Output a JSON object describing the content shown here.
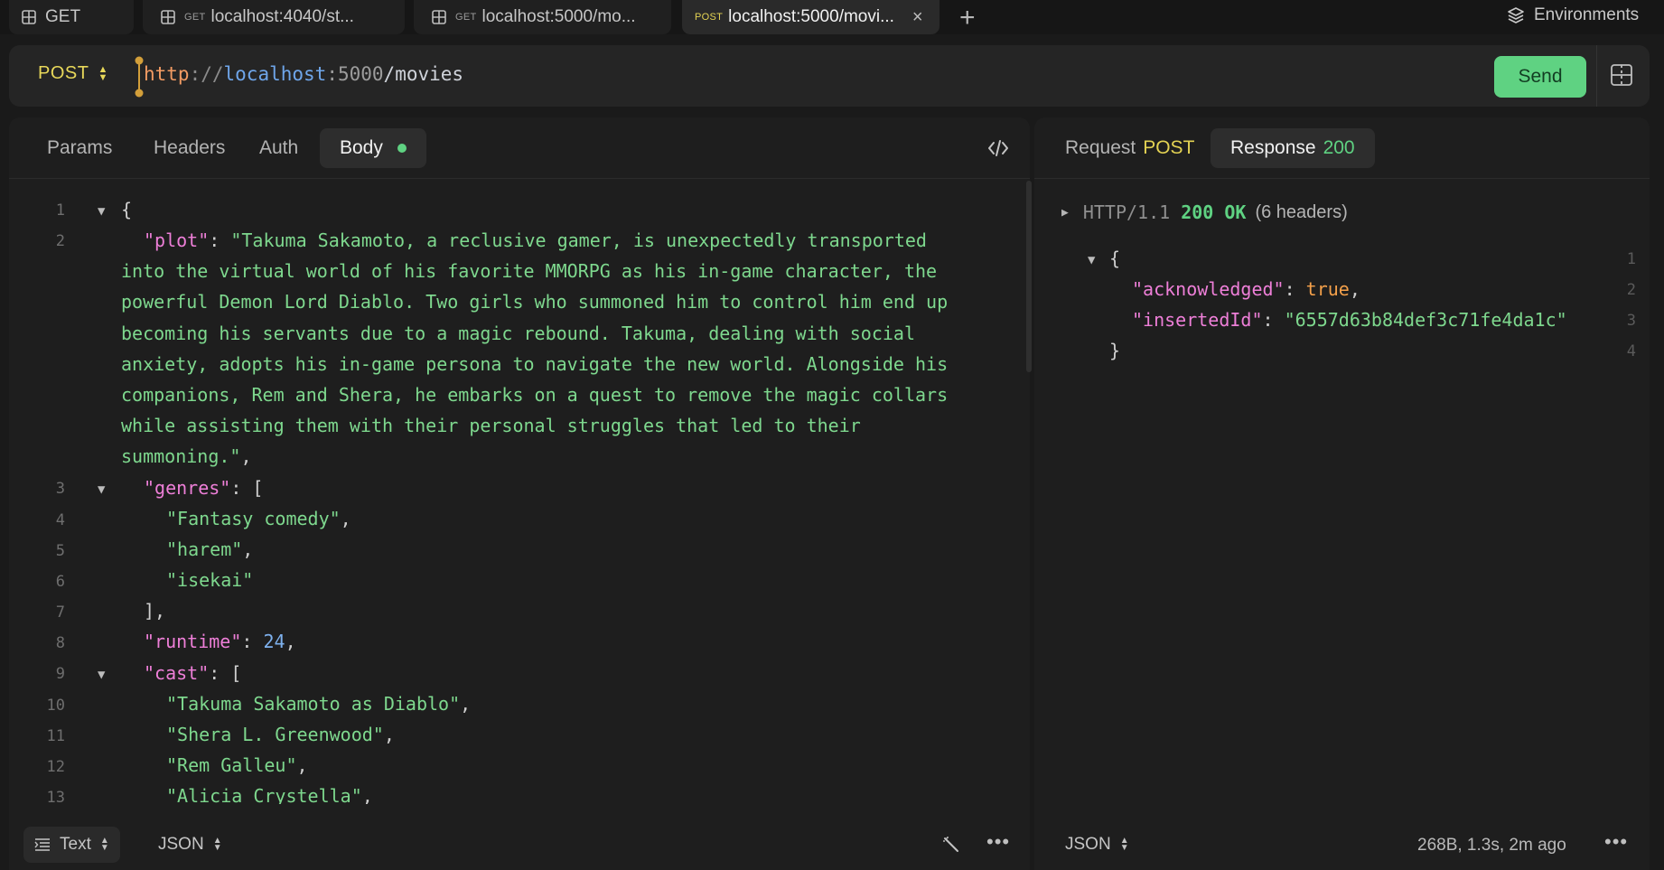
{
  "tabs": [
    {
      "method": "",
      "label": "GET"
    },
    {
      "method": "GET",
      "label": "localhost:4040/st..."
    },
    {
      "method": "GET",
      "label": "localhost:5000/mo..."
    },
    {
      "method": "POST",
      "label": "localhost:5000/movi...",
      "close": "×"
    }
  ],
  "new_tab": "+",
  "environments_label": "Environments",
  "request": {
    "method": "POST",
    "url": {
      "scheme": "http",
      "sep": "://",
      "host": "localhost",
      "colon": ":",
      "port": "5000",
      "path": "/movies"
    },
    "send_label": "Send"
  },
  "request_tabs": [
    "Params",
    "Headers",
    "Auth",
    "Body"
  ],
  "body_lines": [
    {
      "n": "1",
      "text": "{"
    },
    {
      "n": "2",
      "key": "\"plot\"",
      "colon": ": ",
      "value": "\"Takuma Sakamoto, a reclusive gamer, is unexpectedly transported"
    },
    {
      "n": "",
      "value": "into the virtual world of his favorite MMORPG as his in-game character, the"
    },
    {
      "n": "",
      "value": "powerful Demon Lord Diablo. Two girls who summoned him to control him end up"
    },
    {
      "n": "",
      "value": "becoming his servants due to a magic rebound. Takuma, dealing with social"
    },
    {
      "n": "",
      "value": "anxiety, adopts his in-game persona to navigate the new world. Alongside his"
    },
    {
      "n": "",
      "value": "companions, Rem and Shera, he embarks on a quest to remove the magic collars"
    },
    {
      "n": "",
      "value": "while assisting them with their personal struggles that led to their"
    },
    {
      "n": "",
      "value": "summoning.\"",
      "tail": ","
    },
    {
      "n": "3",
      "key": "\"genres\"",
      "colon": ": ",
      "tail": "["
    },
    {
      "n": "4",
      "value": "\"Fantasy comedy\"",
      "tail": ","
    },
    {
      "n": "5",
      "value": "\"harem\"",
      "tail": ","
    },
    {
      "n": "6",
      "value": "\"isekai\""
    },
    {
      "n": "7",
      "tail": "],"
    },
    {
      "n": "8",
      "key": "\"runtime\"",
      "colon": ": ",
      "num": "24",
      "tail": ","
    },
    {
      "n": "9",
      "key": "\"cast\"",
      "colon": ": ",
      "tail": "["
    },
    {
      "n": "10",
      "value": "\"Takuma Sakamoto as Diablo\"",
      "tail": ","
    },
    {
      "n": "11",
      "value": "\"Shera L. Greenwood\"",
      "tail": ","
    },
    {
      "n": "12",
      "value": "\"Rem Galleu\"",
      "tail": ","
    },
    {
      "n": "13",
      "value": "\"Alicia Crystella\"",
      "tail": ","
    }
  ],
  "left_footer": {
    "mode": "Text",
    "format": "JSON"
  },
  "response": {
    "request_tab": "Request",
    "request_method": "POST",
    "response_tab": "Response",
    "status_code": "200",
    "status_line": {
      "proto": "HTTP/1.1",
      "code": "200",
      "text": "OK",
      "headers": "(6 headers)"
    },
    "lines": [
      {
        "n": "1",
        "text": "{"
      },
      {
        "n": "2",
        "key": "\"acknowledged\"",
        "colon": ": ",
        "bool": "true",
        "tail": ","
      },
      {
        "n": "3",
        "key": "\"insertedId\"",
        "colon": ": ",
        "value": "\"6557d63b84def3c71fe4da1c\""
      },
      {
        "n": "4",
        "text": "}"
      }
    ],
    "footer": {
      "format": "JSON",
      "meta": "268B, 1.3s, 2m ago"
    }
  },
  "colors": {
    "send": "#5fd282",
    "method_post": "#e3d253",
    "json_key": "#ee7fd8",
    "json_string": "#7ed88e",
    "json_number": "#7eb1ee",
    "json_bool": "#f4a04a"
  }
}
